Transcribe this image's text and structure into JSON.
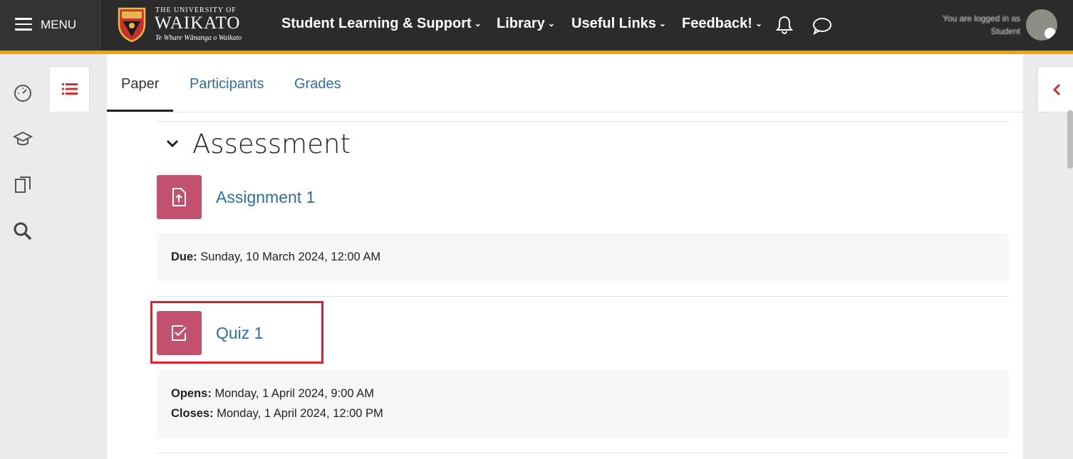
{
  "topbar": {
    "menu_label": "MENU",
    "logo": {
      "line1": "THE UNIVERSITY OF",
      "line2": "WAIKATO",
      "line3": "Te Whare Wānanga o Waikato"
    },
    "nav": [
      {
        "label": "Student Learning & Support"
      },
      {
        "label": "Library"
      },
      {
        "label": "Useful Links"
      },
      {
        "label": "Feedback!"
      }
    ],
    "user": {
      "line1": "You are logged in as",
      "line2": "Student"
    },
    "accent_color": "#f5a300"
  },
  "left_rail": {
    "icons": [
      "dashboard-icon",
      "graduation-cap-icon",
      "paper-copy-icon",
      "search-icon"
    ]
  },
  "tabs": [
    {
      "label": "Paper",
      "active": true
    },
    {
      "label": "Participants",
      "active": false
    },
    {
      "label": "Grades",
      "active": false
    }
  ],
  "section": {
    "title": "Assessment",
    "activities": [
      {
        "name": "Assignment 1",
        "icon": "assignment-upload-icon",
        "dates": [
          {
            "label": "Due:",
            "value": "Sunday, 10 March 2024, 12:00 AM"
          }
        ]
      },
      {
        "name": "Quiz 1",
        "icon": "quiz-check-icon",
        "dates": [
          {
            "label": "Opens:",
            "value": "Monday, 1 April 2024, 9:00 AM"
          },
          {
            "label": "Closes:",
            "value": "Monday, 1 April 2024, 12:00 PM"
          }
        ]
      }
    ]
  },
  "colors": {
    "activity_icon_bg": "#c1516e",
    "link": "#2f6da6",
    "highlight": "#e0202a"
  }
}
